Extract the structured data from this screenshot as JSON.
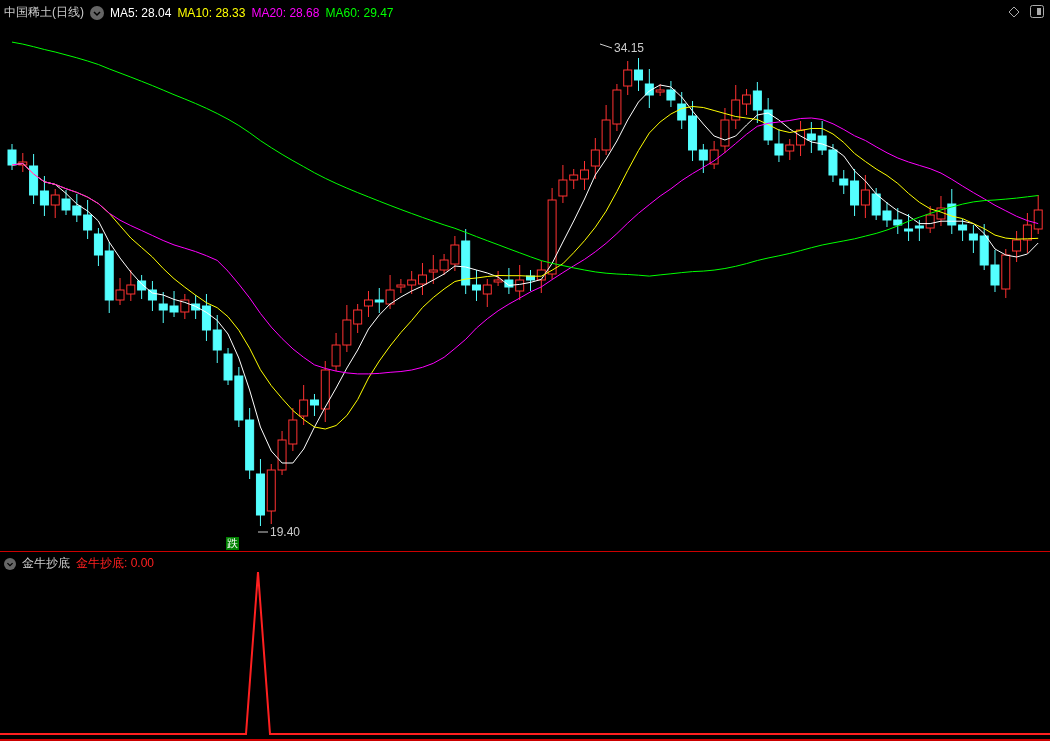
{
  "main_chart": {
    "title": "中国稀土(日线)",
    "moving_averages": [
      {
        "label": "MA5: 28.04",
        "color": "#ffffff"
      },
      {
        "label": "MA10: 28.33",
        "color": "#ffff00"
      },
      {
        "label": "MA20: 28.68",
        "color": "#ff00ff"
      },
      {
        "label": "MA60: 29.47",
        "color": "#00ff00"
      }
    ],
    "high_label": "34.15",
    "low_label": "19.40",
    "signal_badge": "跌"
  },
  "indicator": {
    "title": "金牛抄底",
    "legend": "金牛抄底: 0.00"
  }
}
